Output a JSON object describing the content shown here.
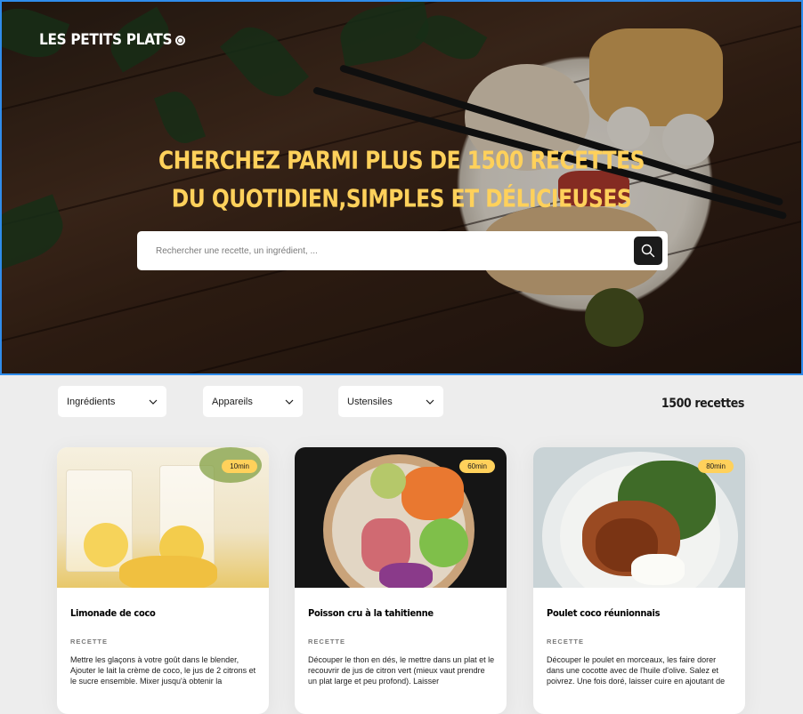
{
  "header": {
    "logo": "LES PETITS PLATS",
    "headline_line1": "CHERCHEZ PARMI PLUS DE 1500 RECETTES",
    "headline_line2": "DU QUOTIDIEN,SIMPLES ET DÉLICIEUSES",
    "search": {
      "placeholder": "Rechercher une recette, un ingrédient, ...",
      "value": ""
    }
  },
  "filters": [
    {
      "label": "Ingrédients"
    },
    {
      "label": "Appareils"
    },
    {
      "label": "Ustensiles"
    }
  ],
  "recipe_count": "1500 recettes",
  "recipes": [
    {
      "title": "Limonade de coco",
      "time": "10min",
      "section": "RECETTE",
      "description": "Mettre les glaçons à votre goût dans le blender, Ajouter le lait  la crème de coco, le jus de 2 citrons et le sucre ensemble. Mixer jusqu'à obtenir la"
    },
    {
      "title": "Poisson cru à la tahitienne",
      "time": "60min",
      "section": "RECETTE",
      "description": "Découper le thon en dés, le mettre dans un plat et le recouvrir de jus de citron vert (mieux vaut prendre un plat large et peu profond). Laisser"
    },
    {
      "title": "Poulet coco réunionnais",
      "time": "80min",
      "section": "RECETTE",
      "description": "Découper le poulet en morceaux, les faire dorer dans une cocotte avec de l'huile d'olive. Salez et poivrez. Une fois doré, laisser cuire en ajoutant de"
    }
  ],
  "colors": {
    "accent": "#FFD15B",
    "dark": "#1B1B1B",
    "background": "#EDEDED",
    "hero_border": "#2F8CEB"
  },
  "icons": {
    "search": "search-icon",
    "chevron": "chevron-down-icon",
    "logo_mark": "circle-dot-icon"
  }
}
